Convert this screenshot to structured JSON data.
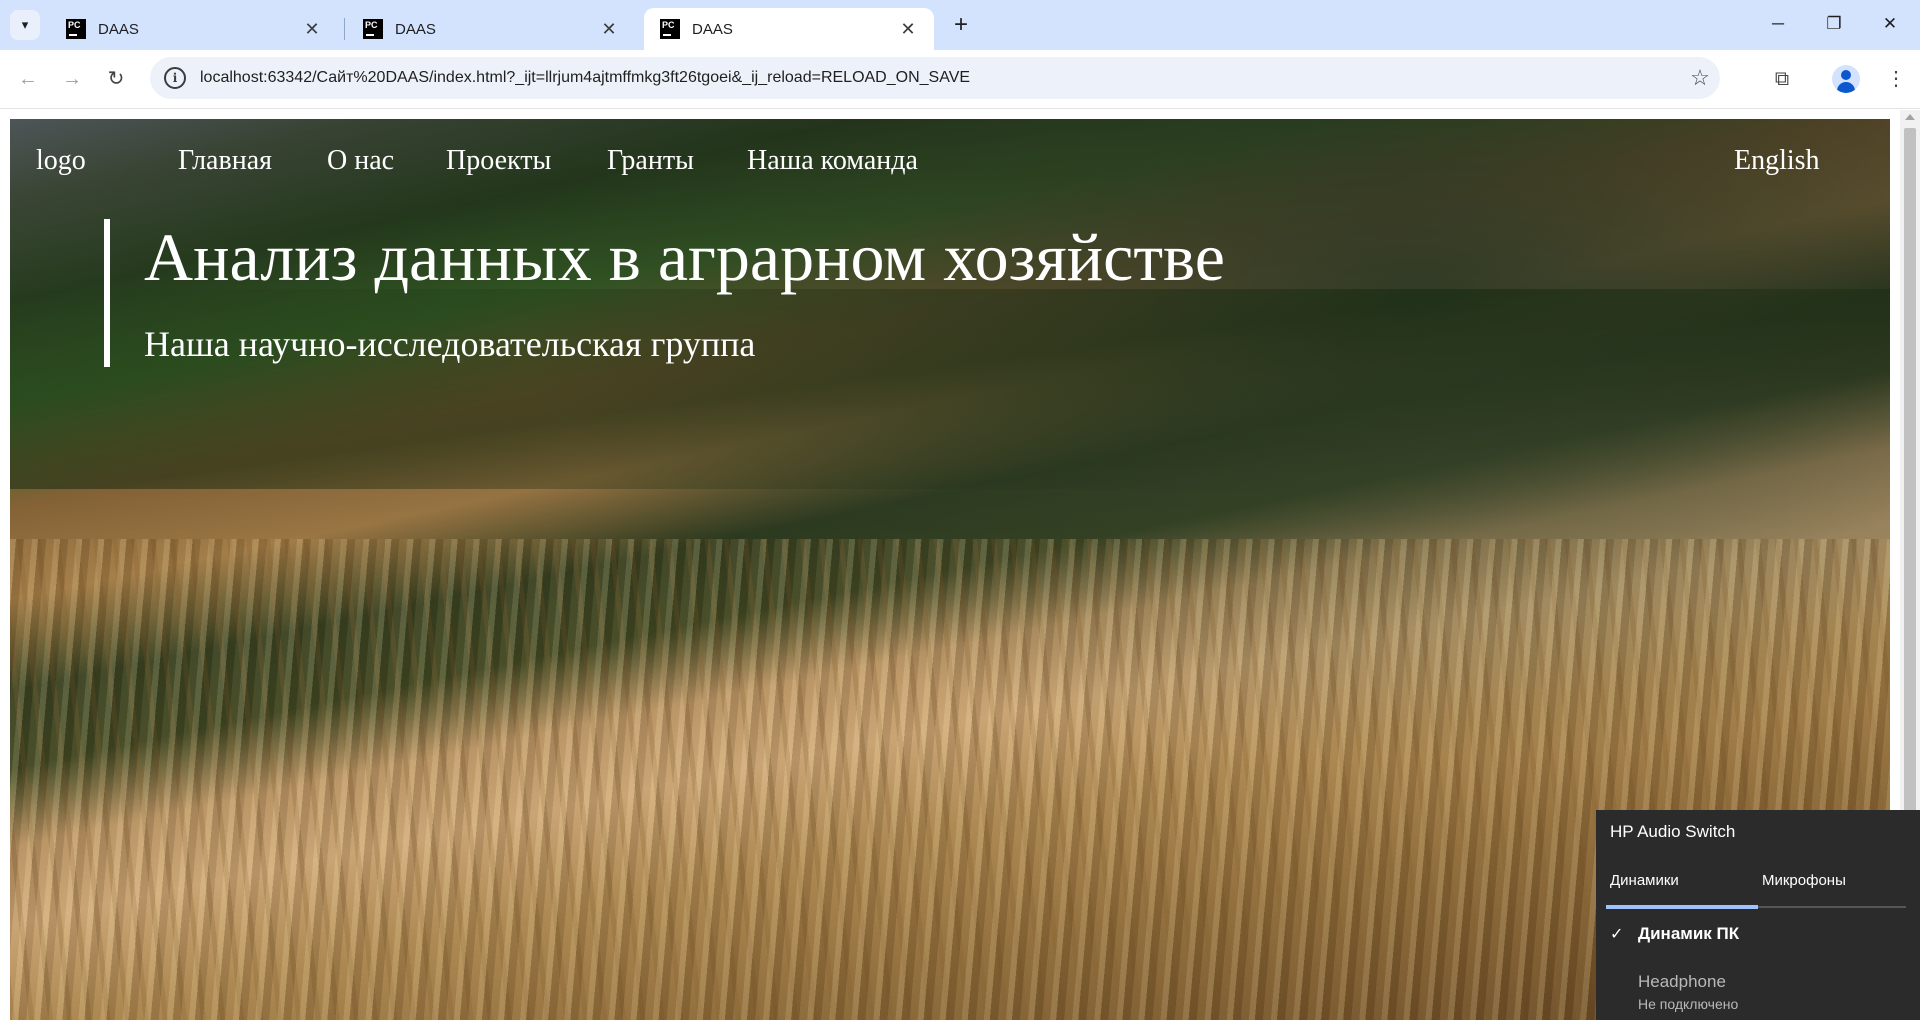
{
  "browser": {
    "tabs": [
      {
        "title": "DAAS",
        "favicon": "PC",
        "active": false
      },
      {
        "title": "DAAS",
        "favicon": "PC",
        "active": false
      },
      {
        "title": "DAAS",
        "favicon": "PC",
        "active": true
      }
    ],
    "url": "localhost:63342/Сайт%20DAAS/index.html?_ijt=llrjum4ajtmffmkg3ft26tgoei&_ij_reload=RELOAD_ON_SAVE",
    "icons": {
      "tab_list": "chevron-down-icon",
      "new_tab": "plus-icon",
      "back": "back-arrow-icon",
      "forward": "forward-arrow-icon",
      "reload": "reload-icon",
      "site_info": "info-icon",
      "bookmark": "star-icon",
      "extensions": "puzzle-icon",
      "profile": "profile-avatar-icon",
      "menu": "kebab-menu-icon"
    }
  },
  "site": {
    "logo": "logo",
    "nav": [
      "Главная",
      "О нас",
      "Проекты",
      "Гранты",
      "Наша команда"
    ],
    "language": "English",
    "headline": "Анализ данных в аграрном хозяйстве",
    "subtitle": "Наша научно-исследовательская группа"
  },
  "audio_switch": {
    "title": "HP Audio Switch",
    "tabs": [
      "Динамики",
      "Микрофоны"
    ],
    "active_tab": "Динамики",
    "devices": [
      {
        "name": "Динамик ПК",
        "selected": true,
        "status": ""
      },
      {
        "name": "Headphone",
        "selected": false,
        "status": "Не подключено"
      }
    ]
  },
  "colors": {
    "tabbar_bg": "#d3e3fd",
    "omnibox_bg": "#edf2fa",
    "audio_panel_bg": "#2b2b2b",
    "audio_tab_accent": "#9ec3ff"
  }
}
